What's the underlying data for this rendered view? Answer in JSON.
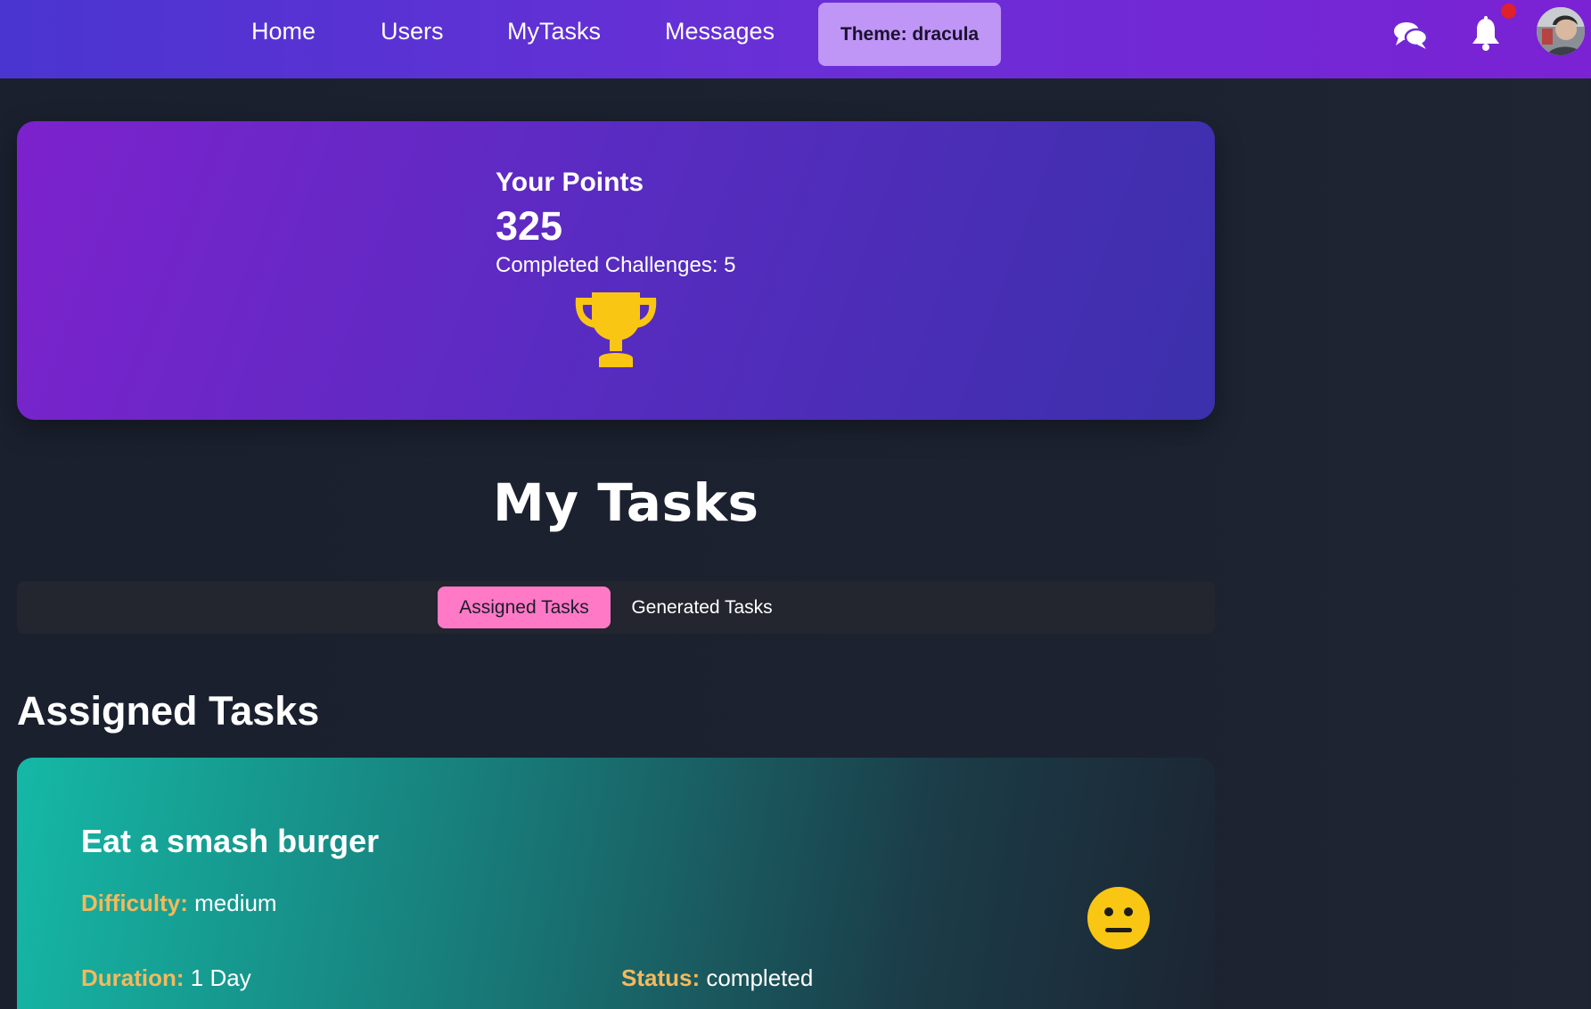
{
  "nav": {
    "links": [
      {
        "label": "Home"
      },
      {
        "label": "Users"
      },
      {
        "label": "MyTasks"
      },
      {
        "label": "Messages"
      }
    ],
    "theme_button": "Theme: dracula",
    "icons": [
      "chat-icon",
      "bell-icon",
      "avatar"
    ]
  },
  "points": {
    "title": "Your Points",
    "value": "325",
    "completed": "Completed Challenges: 5",
    "icon": "trophy-icon"
  },
  "page": {
    "title": "My Tasks"
  },
  "tabs": [
    {
      "label": "Assigned Tasks",
      "active": true
    },
    {
      "label": "Generated Tasks",
      "active": false
    }
  ],
  "section": {
    "title": "Assigned Tasks"
  },
  "task": {
    "title": "Eat a smash burger",
    "difficulty_label": "Difficulty:",
    "difficulty_value": " medium",
    "duration_label": "Duration:",
    "duration_value": " 1 Day",
    "status_label": "Status:",
    "status_value": " completed",
    "icon": "neutral-face-icon"
  },
  "colors": {
    "accent_pink": "#ff79c6",
    "label_orange": "#f5b95c",
    "trophy_gold": "#f9c614",
    "theme_button": "#bf95f5"
  }
}
